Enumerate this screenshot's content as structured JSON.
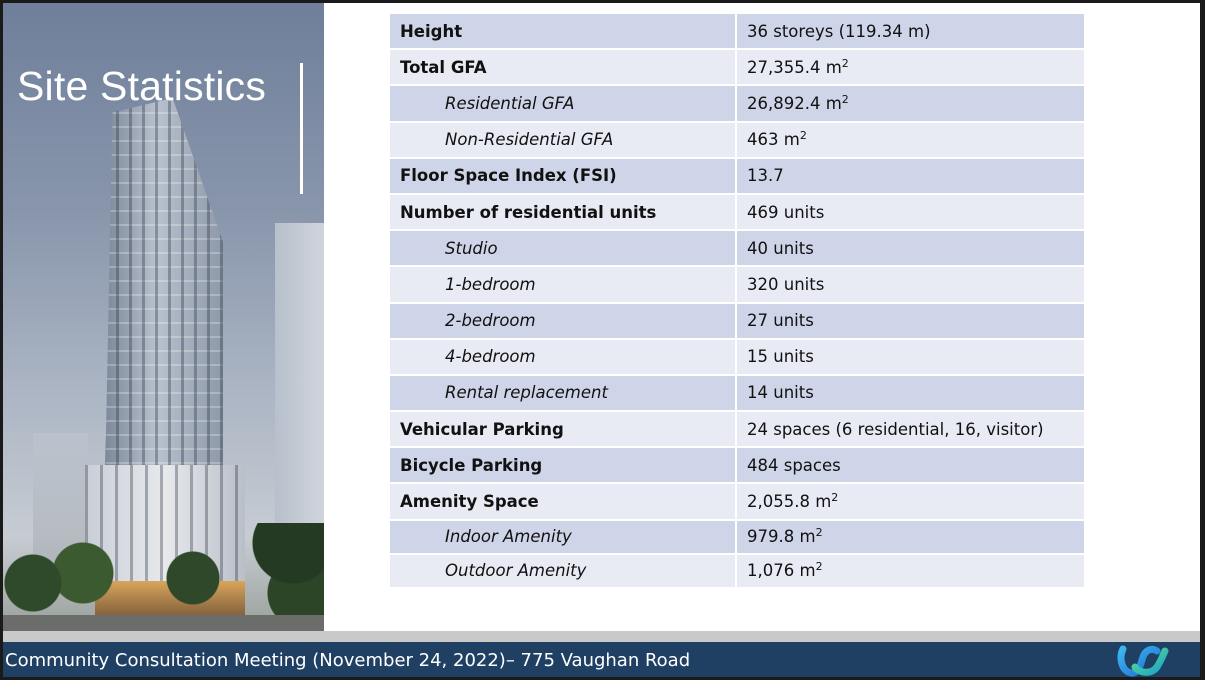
{
  "slide": {
    "title": "Site Statistics"
  },
  "table": {
    "rows": [
      {
        "label": "Height",
        "value": "36 storeys (119.34 m)",
        "level": "main",
        "unit": ""
      },
      {
        "label": "Total GFA",
        "value": "27,355.4 m",
        "level": "main",
        "unit": "2"
      },
      {
        "label": "Residential GFA",
        "value": "26,892.4 m",
        "level": "sub",
        "unit": "2"
      },
      {
        "label": "Non-Residential GFA",
        "value": "463 m",
        "level": "sub",
        "unit": "2"
      },
      {
        "label": "Floor Space Index (FSI)",
        "value": "13.7",
        "level": "main",
        "unit": ""
      },
      {
        "label": "Number of residential units",
        "value": "469 units",
        "level": "main",
        "unit": ""
      },
      {
        "label": "Studio",
        "value": "40 units",
        "level": "sub",
        "unit": ""
      },
      {
        "label": "1-bedroom",
        "value": "320 units",
        "level": "sub",
        "unit": ""
      },
      {
        "label": "2-bedroom",
        "value": "27 units",
        "level": "sub",
        "unit": ""
      },
      {
        "label": "4-bedroom",
        "value": "15 units",
        "level": "sub",
        "unit": ""
      },
      {
        "label": "Rental replacement",
        "value": "14 units",
        "level": "sub",
        "unit": ""
      },
      {
        "label": "Vehicular Parking",
        "value": "24 spaces (6 residential, 16, visitor)",
        "level": "main",
        "unit": ""
      },
      {
        "label": "Bicycle Parking",
        "value": "484 spaces",
        "level": "main",
        "unit": ""
      },
      {
        "label": "Amenity Space",
        "value": "2,055.8 m",
        "level": "main",
        "unit": "2"
      },
      {
        "label": "Indoor Amenity",
        "value": "979.8 m",
        "level": "sub",
        "unit": "2"
      },
      {
        "label": "Outdoor Amenity",
        "value": "1,076 m",
        "level": "sub",
        "unit": "2"
      }
    ]
  },
  "footer": {
    "text": "Community Consultation Meeting (November 24, 2022)– 775 Vaughan Road"
  },
  "icons": {
    "app_logo": "webex-logo-icon"
  },
  "colors": {
    "row_odd": "#cfd5e8",
    "row_even": "#e8ebf4",
    "footer_bg": "#1f3f63"
  }
}
